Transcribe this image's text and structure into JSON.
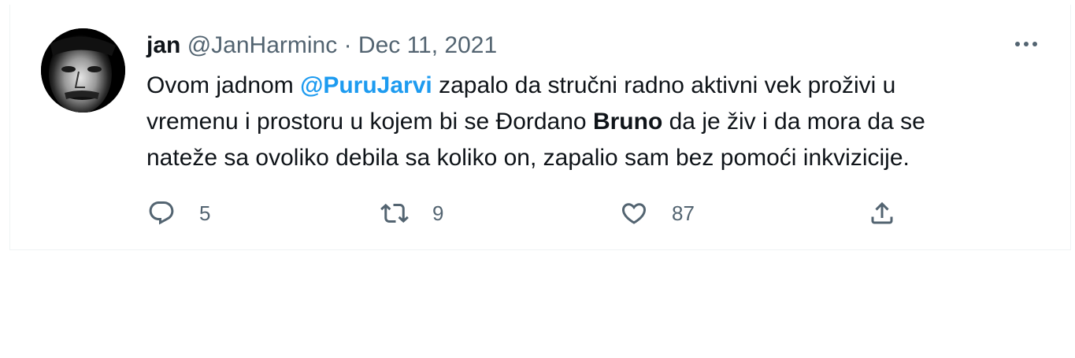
{
  "tweet": {
    "author": {
      "name": "jan",
      "handle": "@JanHarminc",
      "separator": "·",
      "date": "Dec 11, 2021"
    },
    "body": {
      "line1_prefix": "Ovom jadnom ",
      "mention": "@PuruJarvi",
      "line1_suffix": " zapalo da stručni radno aktivni vek proživi u",
      "line2_prefix": "vremenu i prostoru u kojem bi se Đordano ",
      "bold_word": "Bruno",
      "line2_suffix": " da je živ i da mora da se",
      "line3": "nateže sa ovoliko debila sa koliko on, zapalio sam bez pomoći inkvizicije."
    },
    "actions": {
      "reply": {
        "icon": "reply-icon",
        "count": "5"
      },
      "retweet": {
        "icon": "retweet-icon",
        "count": "9"
      },
      "like": {
        "icon": "heart-icon",
        "count": "87"
      },
      "share": {
        "icon": "share-icon"
      }
    },
    "more_icon": "more-options-icon"
  },
  "colors": {
    "text": "#0f1419",
    "secondary": "#536471",
    "accent": "#1d9bf0",
    "border": "#eff3f4"
  }
}
